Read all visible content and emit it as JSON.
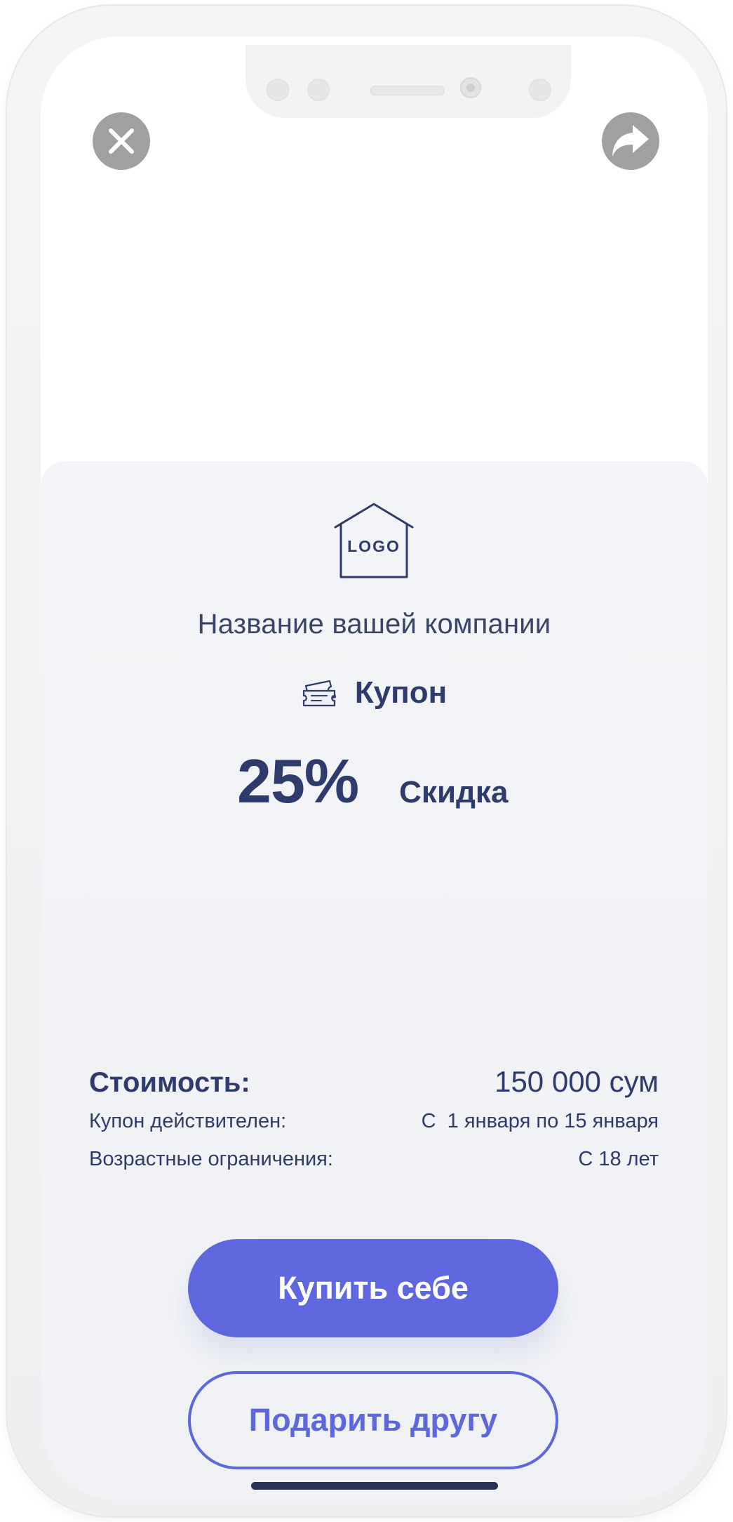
{
  "colors": {
    "accent": "#5e67dd",
    "text_primary": "#2f3b6c",
    "icon_button_bg": "#a0a0a0",
    "card_bg": "#f3f4f7"
  },
  "icons": {
    "close": "close-icon",
    "share": "share-icon",
    "logo": "logo-house-icon",
    "coupon": "ticket-icon"
  },
  "logo": {
    "text": "LOGO"
  },
  "company": {
    "name": "Название вашей компании"
  },
  "coupon": {
    "title": "Купон",
    "discount_value": "25%",
    "discount_label": "Скидка"
  },
  "details": {
    "price_label": "Стоимость:",
    "price_value": "150 000 сум",
    "validity_label": "Купон действителен:",
    "validity_value": "С  1 января по 15 января",
    "age_label": "Возрастные ограничения:",
    "age_value": "С 18 лет"
  },
  "actions": {
    "buy_label": "Купить себе",
    "gift_label": "Подарить другу"
  }
}
